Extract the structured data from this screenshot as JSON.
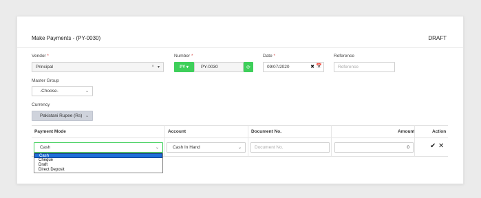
{
  "header": {
    "title": "Make Payments - (PY-0030)",
    "status": "DRAFT"
  },
  "vendor": {
    "label": "Vendor",
    "required_mark": "*",
    "value": "Principal",
    "clear_glyph": "×",
    "arrow_glyph": "▾"
  },
  "number": {
    "label": "Number",
    "required_mark": "*",
    "prefix": "PY",
    "prefix_caret": "▾",
    "value": "PY-0030",
    "refresh_glyph": "⟳"
  },
  "date": {
    "label": "Date",
    "required_mark": "*",
    "value": "09/07/2020",
    "clear_glyph": "✖",
    "calendar_glyph": "📅"
  },
  "reference": {
    "label": "Reference",
    "placeholder": "Reference"
  },
  "master_group": {
    "label": "Master Group",
    "value": "-Choose-",
    "arrow_glyph": "⌄"
  },
  "currency": {
    "label": "Currency",
    "value": "Pakistani Rupee (Rs)",
    "arrow_glyph": "⌄"
  },
  "table": {
    "headers": {
      "payment_mode": "Payment Mode",
      "account": "Account",
      "document_no": "Document No.",
      "amount": "Amount",
      "action": "Action"
    },
    "row": {
      "payment_mode": "Cash",
      "account": "Cash In Hand",
      "document_placeholder": "Document No.",
      "amount": "0",
      "confirm_glyph": "✔",
      "remove_glyph": "✕",
      "arrow_glyph": "⌄"
    }
  },
  "payment_mode_dropdown": {
    "options": [
      "Cash",
      "Cheque",
      "Draft",
      "Direct Deposit"
    ],
    "selected": "Cash"
  },
  "colors": {
    "accent_green": "#3ecf5a",
    "selection_blue": "#1e6fd9",
    "required_red": "#d9534f"
  }
}
